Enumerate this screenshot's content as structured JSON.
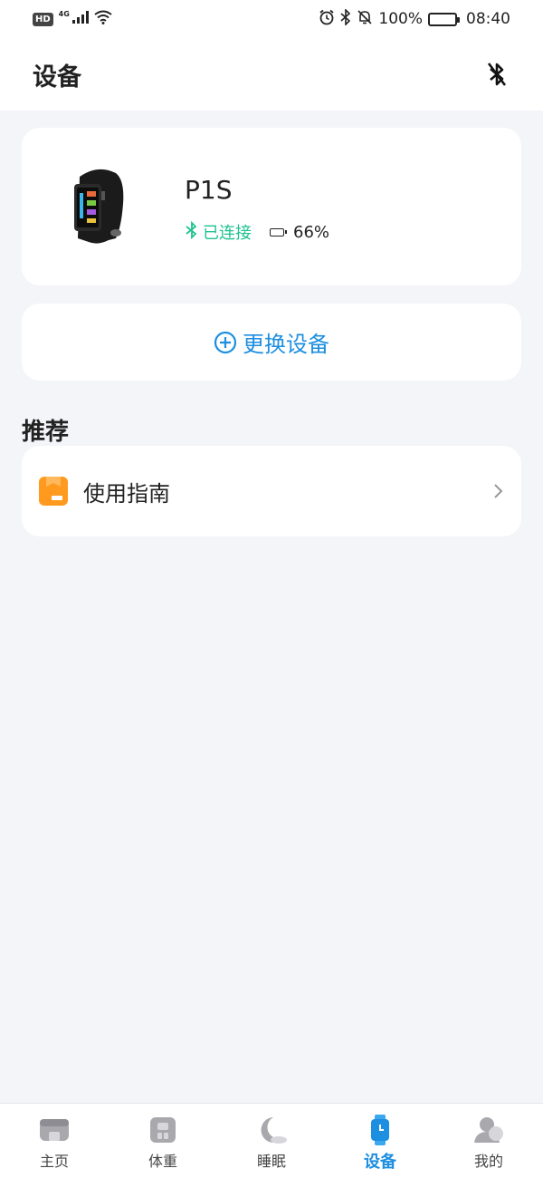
{
  "status_bar": {
    "hd": "HD",
    "network": "4G",
    "battery_percent": "100%",
    "time": "08:40"
  },
  "header": {
    "title": "设备",
    "bluetooth_icon": "bluetooth-off-icon"
  },
  "device": {
    "name": "P1S",
    "status": "已连接",
    "battery": "66%",
    "battery_level": 0.66,
    "status_color": "#1fc28f"
  },
  "switch_device": {
    "label": "更换设备",
    "icon": "plus-circle-icon",
    "color": "#1d8fe0"
  },
  "recommend": {
    "title": "推荐",
    "items": [
      {
        "label": "使用指南",
        "icon": "guide-book-icon"
      }
    ]
  },
  "tabs": [
    {
      "label": "主页",
      "icon": "home-icon",
      "active": false
    },
    {
      "label": "体重",
      "icon": "scale-icon",
      "active": false
    },
    {
      "label": "睡眠",
      "icon": "moon-icon",
      "active": false
    },
    {
      "label": "设备",
      "icon": "watch-icon",
      "active": true
    },
    {
      "label": "我的",
      "icon": "profile-icon",
      "active": false
    }
  ]
}
